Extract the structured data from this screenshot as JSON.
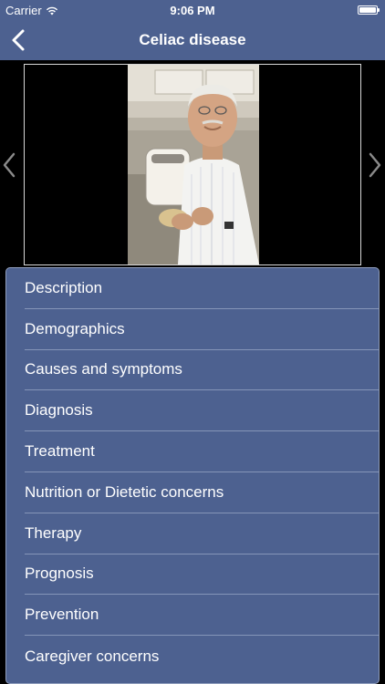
{
  "status_bar": {
    "carrier": "Carrier",
    "time": "9:06 PM",
    "wifi_icon": "wifi-icon",
    "battery_icon": "battery-icon"
  },
  "nav": {
    "title": "Celiac disease",
    "back_icon": "chevron-left-icon"
  },
  "gallery": {
    "prev_icon": "chevron-left-icon",
    "next_icon": "chevron-right-icon"
  },
  "sections": [
    {
      "label": "Description"
    },
    {
      "label": "Demographics"
    },
    {
      "label": "Causes and symptoms"
    },
    {
      "label": "Diagnosis"
    },
    {
      "label": "Treatment"
    },
    {
      "label": "Nutrition or Dietetic concerns"
    },
    {
      "label": "Therapy"
    },
    {
      "label": "Prognosis"
    },
    {
      "label": "Prevention"
    },
    {
      "label": "Caregiver concerns"
    }
  ],
  "colors": {
    "bar": "#4d6190",
    "list_bg": "#4d6190",
    "divider": "#8595b8",
    "background": "#000000"
  }
}
